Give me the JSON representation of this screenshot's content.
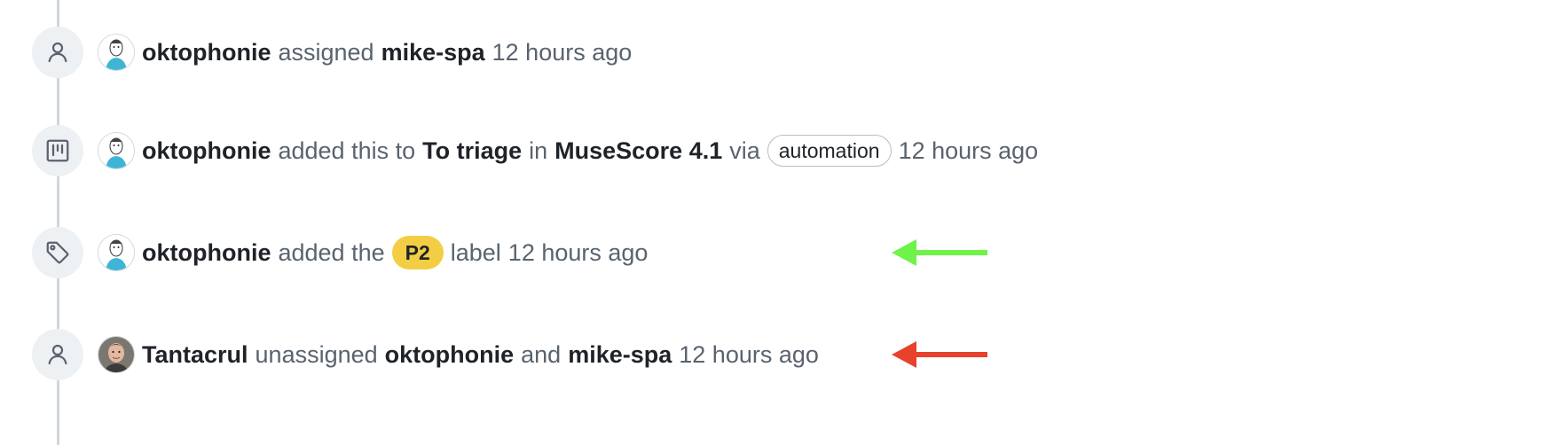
{
  "events": [
    {
      "icon": "person-icon",
      "actor": "oktophonie",
      "verb": "assigned",
      "target": "mike-spa",
      "time": "12 hours ago"
    },
    {
      "icon": "project-icon",
      "actor": "oktophonie",
      "text1": "added this to",
      "column": "To triage",
      "text2": "in",
      "project": "MuseScore 4.1",
      "text3": "via",
      "via_badge": "automation",
      "time": "12 hours ago"
    },
    {
      "icon": "tag-icon",
      "actor": "oktophonie",
      "text1": "added the",
      "label": "P2",
      "text2": "label",
      "time": "12 hours ago",
      "label_color": "#f3ce45"
    },
    {
      "icon": "person-icon",
      "actor": "Tantacrul",
      "verb": "unassigned",
      "target1": "oktophonie",
      "conj": "and",
      "target2": "mike-spa",
      "time": "12 hours ago"
    }
  ],
  "annotations": {
    "green_arrow_color": "#6ff24a",
    "red_arrow_color": "#e8412c"
  }
}
